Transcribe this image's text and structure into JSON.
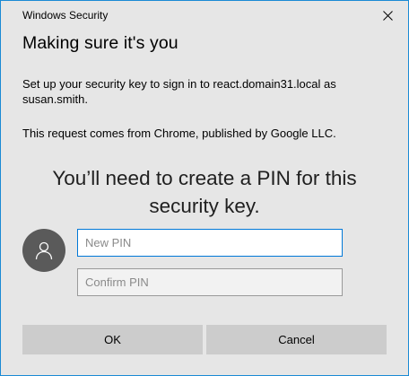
{
  "window": {
    "title": "Windows Security",
    "close_icon": "close-icon"
  },
  "heading": "Making sure it's you",
  "message": {
    "setup": "Set up your security key to sign in to react.domain31.local as susan.smith.",
    "origin": "This request comes from Chrome, published by Google LLC."
  },
  "prompt": "You’ll need to create a PIN for this security key.",
  "avatar_icon": "user-icon",
  "fields": {
    "new_pin": {
      "value": "",
      "placeholder": "New PIN"
    },
    "confirm_pin": {
      "value": "",
      "placeholder": "Confirm PIN"
    }
  },
  "buttons": {
    "ok": "OK",
    "cancel": "Cancel"
  },
  "colors": {
    "dialog_background": "#e6e6e6",
    "border_accent": "#1a8ad4",
    "focus_border": "#0078d7",
    "button_background": "#cccccc",
    "avatar_background": "#5a5a5a"
  }
}
